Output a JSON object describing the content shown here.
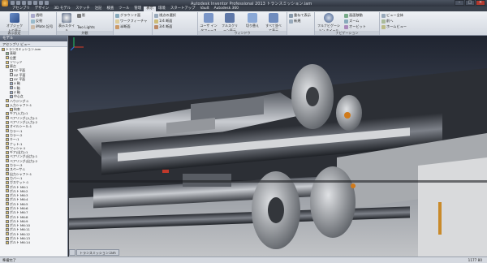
{
  "window": {
    "title": "Autodesk Inventor Professional 2013   トランスミッション.iam",
    "controls": [
      "–",
      "□",
      "×"
    ]
  },
  "ribbon_tabs": [
    "アセンブリ",
    "デザイン",
    "3D モデル",
    "スケッチ",
    "注記",
    "検査",
    "ツール",
    "管理",
    "表示",
    "環境",
    "スタートアップ",
    "Vault",
    "Autodesk 360"
  ],
  "ribbon": {
    "groups": [
      {
        "name": "表示設定",
        "big": "オブジェクトの表示"
      },
      {
        "name": "表示設定",
        "items": [
          "透明",
          "反射",
          "iMate 記号"
        ]
      },
      {
        "name": "外観",
        "big": "表示スタイル",
        "items": [
          "影",
          "Two Lights"
        ]
      },
      {
        "name": "外観",
        "items": [
          "グラウンド面",
          "ワークフィーチャ",
          "半断面",
          "オルソ"
        ]
      },
      {
        "name": "外観",
        "items": [
          "視点の選択",
          "1/4 断面",
          "3/4 断面"
        ]
      },
      {
        "name": "ウィンドウ",
        "bigs": [
          "ユーザ インタフェース",
          "フルスクリーン表示",
          "切り替え",
          "すべて並べて表示"
        ]
      },
      {
        "name": "ウィンドウ",
        "items": [
          "重ねて表示",
          "新規"
        ]
      },
      {
        "name": "ナビゲーション",
        "bigs": [
          "フルナビゲーション ホイール"
        ],
        "items": [
          "画面移動",
          "ズーム",
          "オービット"
        ]
      },
      {
        "name": "ナビゲーション",
        "items": [
          "ビュー全体",
          "前へ",
          "ホームビュー"
        ]
      }
    ]
  },
  "browser": {
    "header": "モデル",
    "view_selector": "アセンブリ ビュー",
    "nodes": [
      {
        "label": "トランスミッション.iam",
        "icon": "asm"
      },
      {
        "label": "表現",
        "icon": "rep"
      },
      {
        "label": "位置",
        "icon": "folder"
      },
      {
        "label": "ソリッド",
        "icon": "folder"
      },
      {
        "label": "原点",
        "icon": "folder"
      },
      {
        "label": "YZ 平面",
        "icon": "plane"
      },
      {
        "label": "XZ 平面",
        "icon": "plane"
      },
      {
        "label": "XY 平面",
        "icon": "plane"
      },
      {
        "label": "X 軸",
        "icon": "axis"
      },
      {
        "label": "Y 軸",
        "icon": "axis"
      },
      {
        "label": "Z 軸",
        "icon": "axis"
      },
      {
        "label": "中心点",
        "icon": "axis"
      },
      {
        "label": "ハウジング:1",
        "icon": "part"
      },
      {
        "label": "入力シャフト:1",
        "icon": "part"
      },
      {
        "label": "拘束",
        "icon": "folder"
      },
      {
        "label": "ギア(入力):1",
        "icon": "part"
      },
      {
        "label": "ベアリング(入力):1",
        "icon": "part"
      },
      {
        "label": "ベアリング(入力):2",
        "icon": "part"
      },
      {
        "label": "オイルシール:1",
        "icon": "part"
      },
      {
        "label": "カラー:1",
        "icon": "part"
      },
      {
        "label": "カラー:2",
        "icon": "part"
      },
      {
        "label": "キー:1",
        "icon": "part"
      },
      {
        "label": "ナット:1",
        "icon": "part"
      },
      {
        "label": "ワッシャ:1",
        "icon": "part"
      },
      {
        "label": "ギア(出力):1",
        "icon": "part"
      },
      {
        "label": "ベアリング(出力):1",
        "icon": "part"
      },
      {
        "label": "ベアリング(出力):2",
        "icon": "part"
      },
      {
        "label": "カラー:3",
        "icon": "part"
      },
      {
        "label": "スペーサ:1",
        "icon": "part"
      },
      {
        "label": "出力シャフト:1",
        "icon": "part"
      },
      {
        "label": "カバー:1",
        "icon": "part"
      },
      {
        "label": "ガスケット:1",
        "icon": "part"
      },
      {
        "label": "ボルト M6:1",
        "icon": "part"
      },
      {
        "label": "ボルト M6:2",
        "icon": "part"
      },
      {
        "label": "ボルト M6:3",
        "icon": "part"
      },
      {
        "label": "ボルト M6:4",
        "icon": "part"
      },
      {
        "label": "ボルト M6:5",
        "icon": "part"
      },
      {
        "label": "ボルト M6:6",
        "icon": "part"
      },
      {
        "label": "ボルト M6:7",
        "icon": "part"
      },
      {
        "label": "ボルト M6:8",
        "icon": "part"
      },
      {
        "label": "ボルト M6:9",
        "icon": "part"
      },
      {
        "label": "ボルト M6:10",
        "icon": "part"
      },
      {
        "label": "ボルト M6:11",
        "icon": "part"
      },
      {
        "label": "ボルト M6:12",
        "icon": "part"
      },
      {
        "label": "ボルト M6:13",
        "icon": "part"
      },
      {
        "label": "ボルト M6:14",
        "icon": "part"
      }
    ]
  },
  "doc_tabs": [
    "トランスミッション.iam"
  ],
  "status": {
    "left": "準備完了",
    "right": "1177   80"
  },
  "colors": {
    "viewport_top": "#1f2430",
    "viewport_bottom": "#c2c4c7",
    "part_gray": "#8b8e93",
    "accent_orange": "#d07a1a",
    "accent_red": "#c0392b"
  }
}
